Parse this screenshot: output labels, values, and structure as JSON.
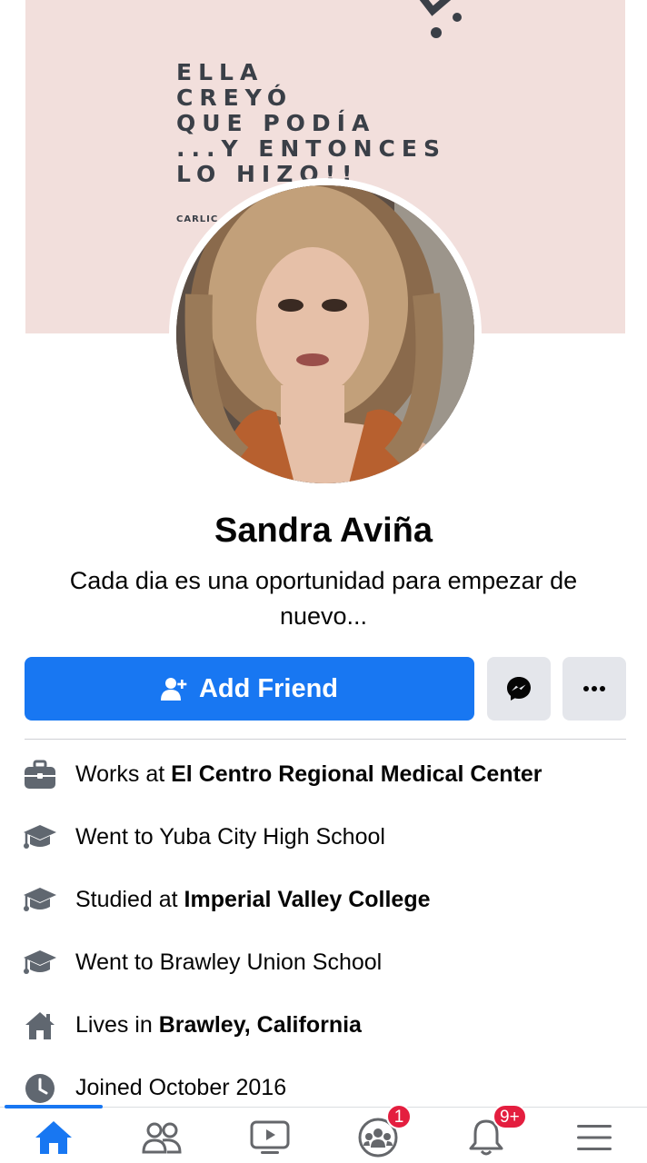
{
  "cover": {
    "quote_lines": [
      "ELLA",
      "CREYÓ",
      "QUE PODÍA",
      "...Y ENTONCES",
      "LO HIZO!!"
    ],
    "credit": "CARLIC"
  },
  "profile": {
    "name": "Sandra Aviña",
    "bio": "Cada dia es una oportunidad para empezar de nuevo..."
  },
  "actions": {
    "add_friend_label": "Add Friend",
    "messenger_icon": "messenger-icon",
    "more_icon": "more-dots-icon"
  },
  "intro": [
    {
      "icon": "work-icon",
      "prefix": "Works at ",
      "bold": "El Centro Regional Medical Center"
    },
    {
      "icon": "education-icon",
      "prefix": "Went to Yuba City High School",
      "bold": ""
    },
    {
      "icon": "education-icon",
      "prefix": "Studied at ",
      "bold": "Imperial Valley College"
    },
    {
      "icon": "education-icon",
      "prefix": "Went to Brawley Union School",
      "bold": ""
    },
    {
      "icon": "home-icon",
      "prefix": "Lives in ",
      "bold": "Brawley, California"
    },
    {
      "icon": "clock-icon",
      "prefix": "Joined October 2016",
      "bold": ""
    }
  ],
  "tabbar": {
    "tabs": [
      "home",
      "friends",
      "watch",
      "groups",
      "notifications",
      "menu"
    ],
    "active": "home",
    "groups_badge": "1",
    "notifications_badge": "9+"
  },
  "colors": {
    "accent": "#1877f2",
    "badge": "#e41e3f",
    "icon_gray": "#606770",
    "cover_bg": "#f2dfdc"
  }
}
